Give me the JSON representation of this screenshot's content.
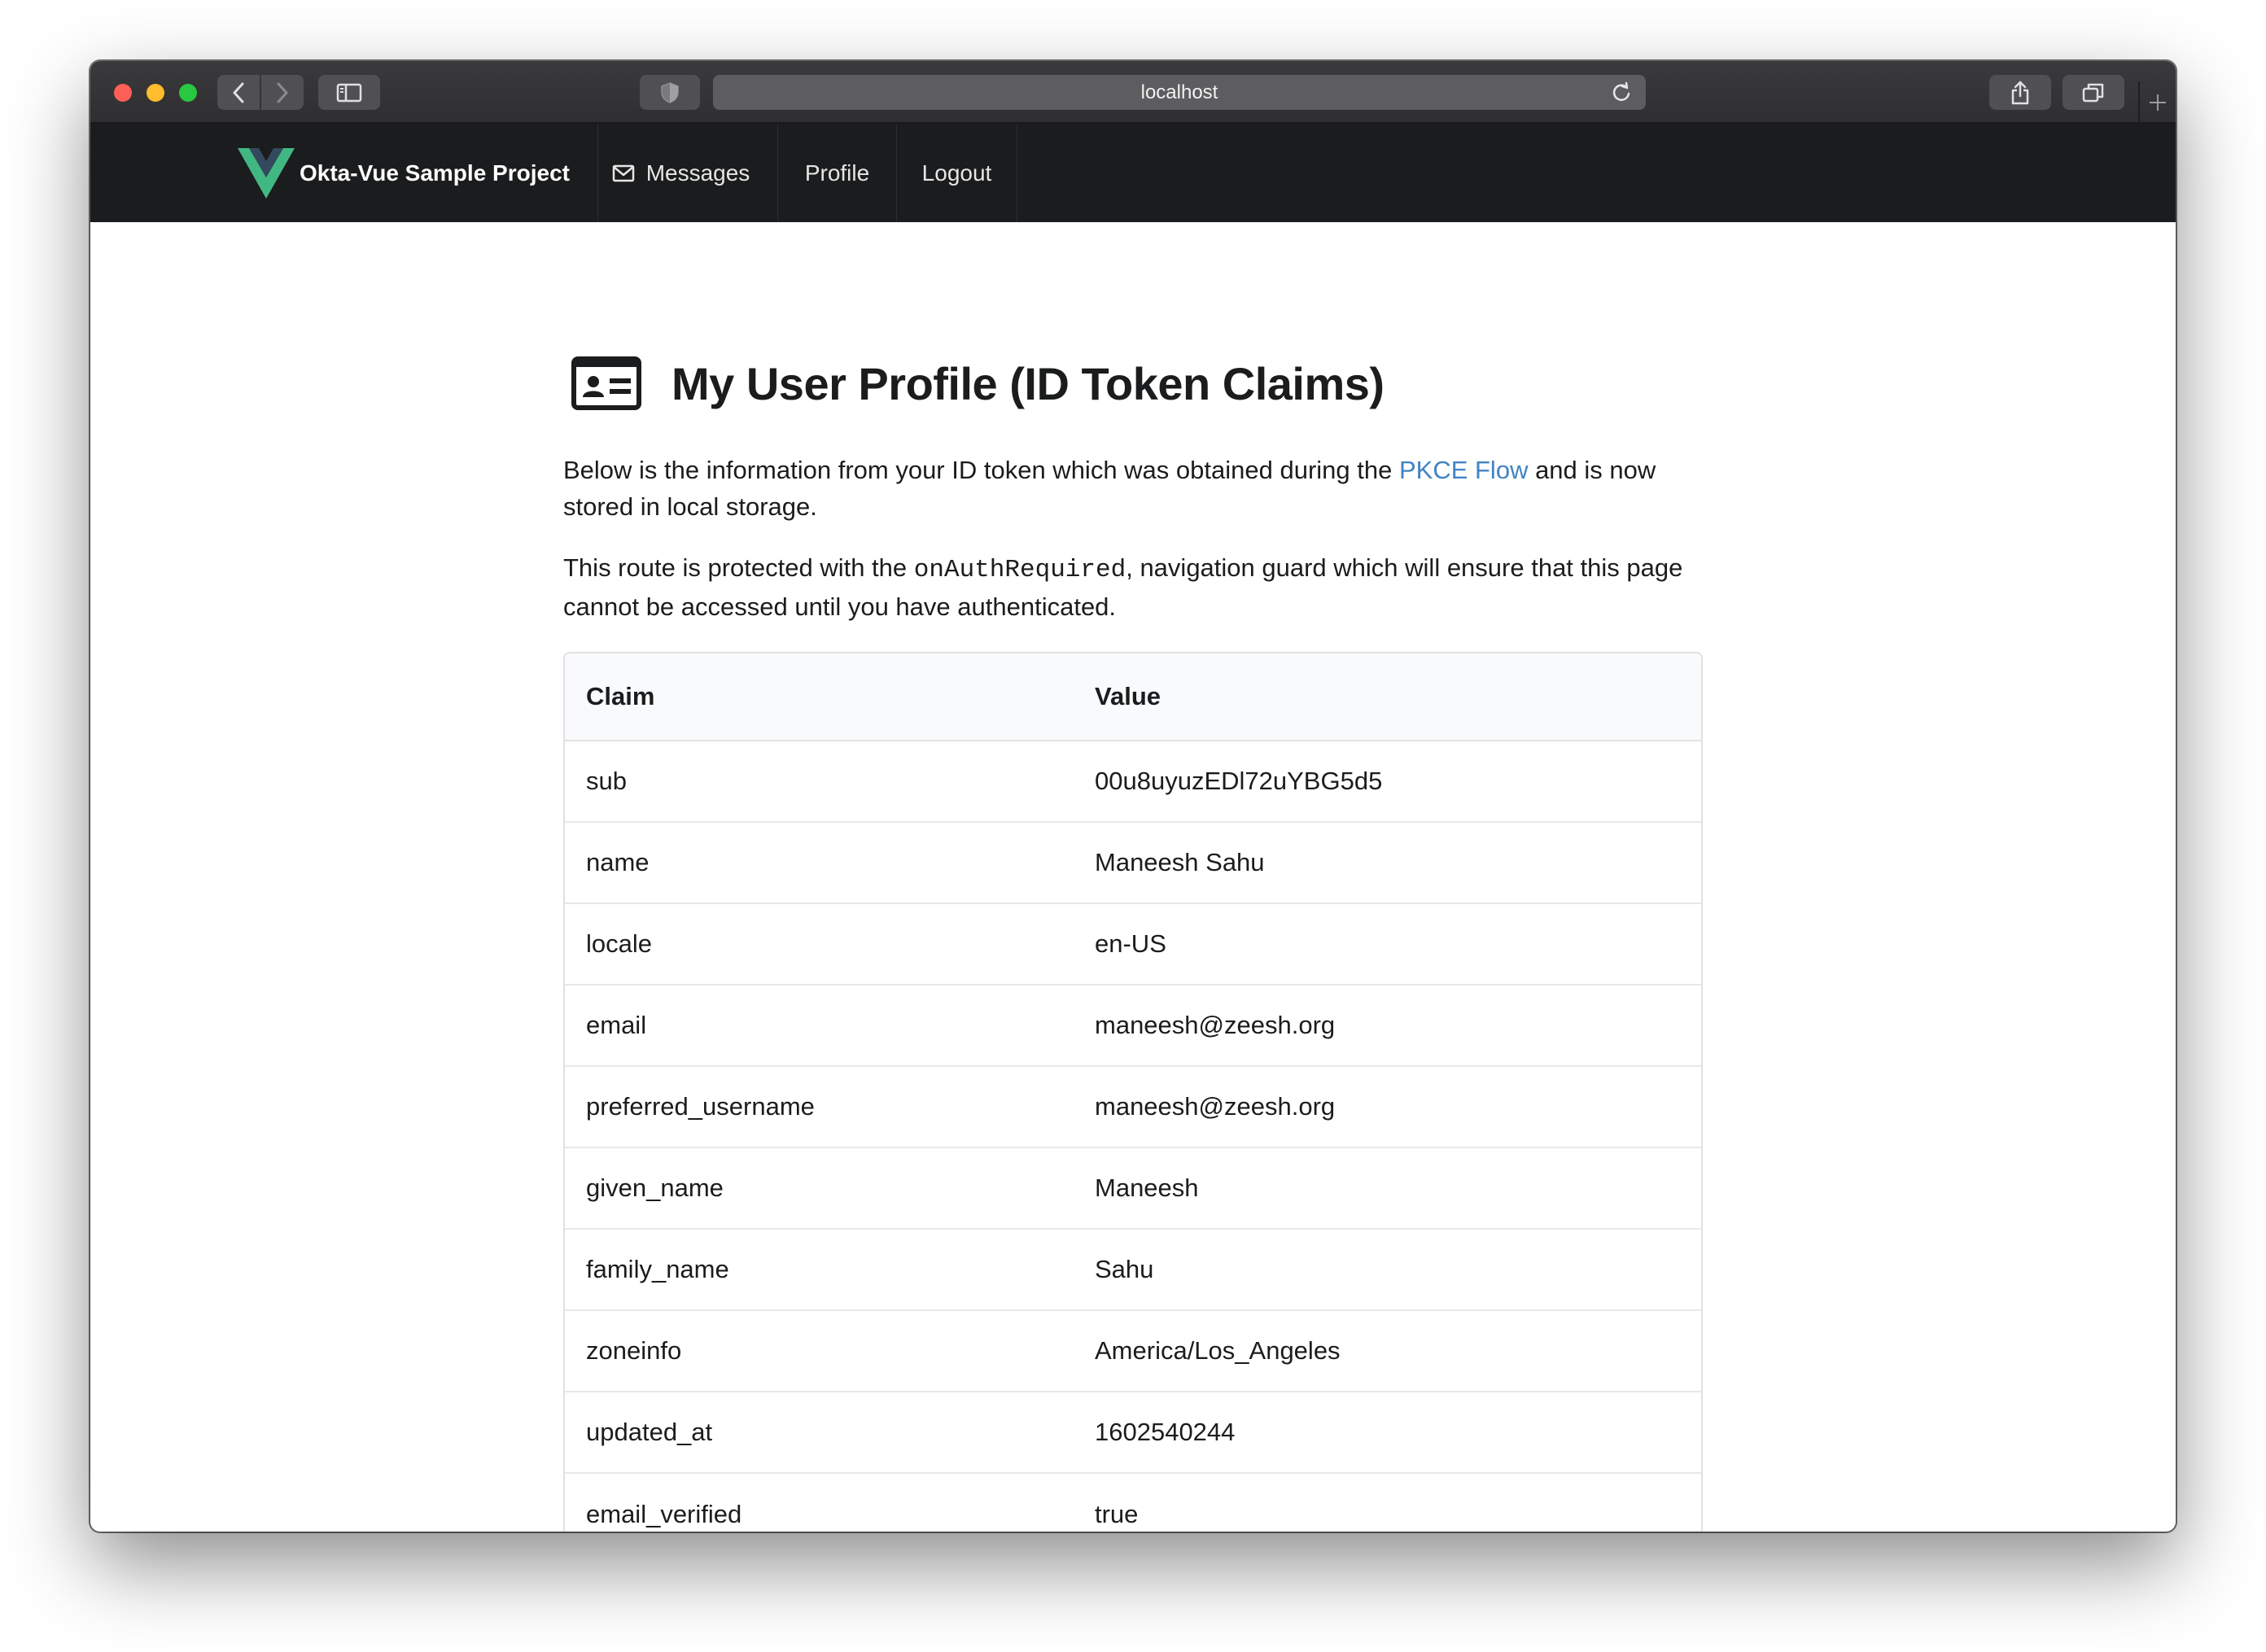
{
  "browser": {
    "url": "localhost"
  },
  "navbar": {
    "brand": "Okta-Vue Sample Project",
    "items": [
      {
        "label": "Messages",
        "icon": "mail-icon"
      },
      {
        "label": "Profile"
      },
      {
        "label": "Logout"
      }
    ]
  },
  "page": {
    "title": "My User Profile (ID Token Claims)",
    "title_icon": "id-card-icon",
    "intro_before_link": "Below is the information from your ID token which was obtained during the ",
    "intro_link": "PKCE Flow",
    "intro_after_link": " and is now stored in local storage.",
    "guard_before_code": "This route is protected with the ",
    "guard_code": "onAuthRequired",
    "guard_after_code": ", navigation guard which will ensure that this page cannot be accessed until you have authenticated."
  },
  "table": {
    "headers": [
      "Claim",
      "Value"
    ],
    "rows": [
      {
        "claim": "sub",
        "value": "00u8uyuzEDl72uYBG5d5"
      },
      {
        "claim": "name",
        "value": "Maneesh Sahu"
      },
      {
        "claim": "locale",
        "value": "en-US"
      },
      {
        "claim": "email",
        "value": "maneesh@zeesh.org"
      },
      {
        "claim": "preferred_username",
        "value": "maneesh@zeesh.org"
      },
      {
        "claim": "given_name",
        "value": "Maneesh"
      },
      {
        "claim": "family_name",
        "value": "Sahu"
      },
      {
        "claim": "zoneinfo",
        "value": "America/Los_Angeles"
      },
      {
        "claim": "updated_at",
        "value": "1602540244"
      },
      {
        "claim": "email_verified",
        "value": "true"
      }
    ]
  },
  "colors": {
    "navbar_bg": "#1b1c1d",
    "link": "#4183c4",
    "vue_green": "#41b883",
    "vue_dark": "#35495e"
  }
}
